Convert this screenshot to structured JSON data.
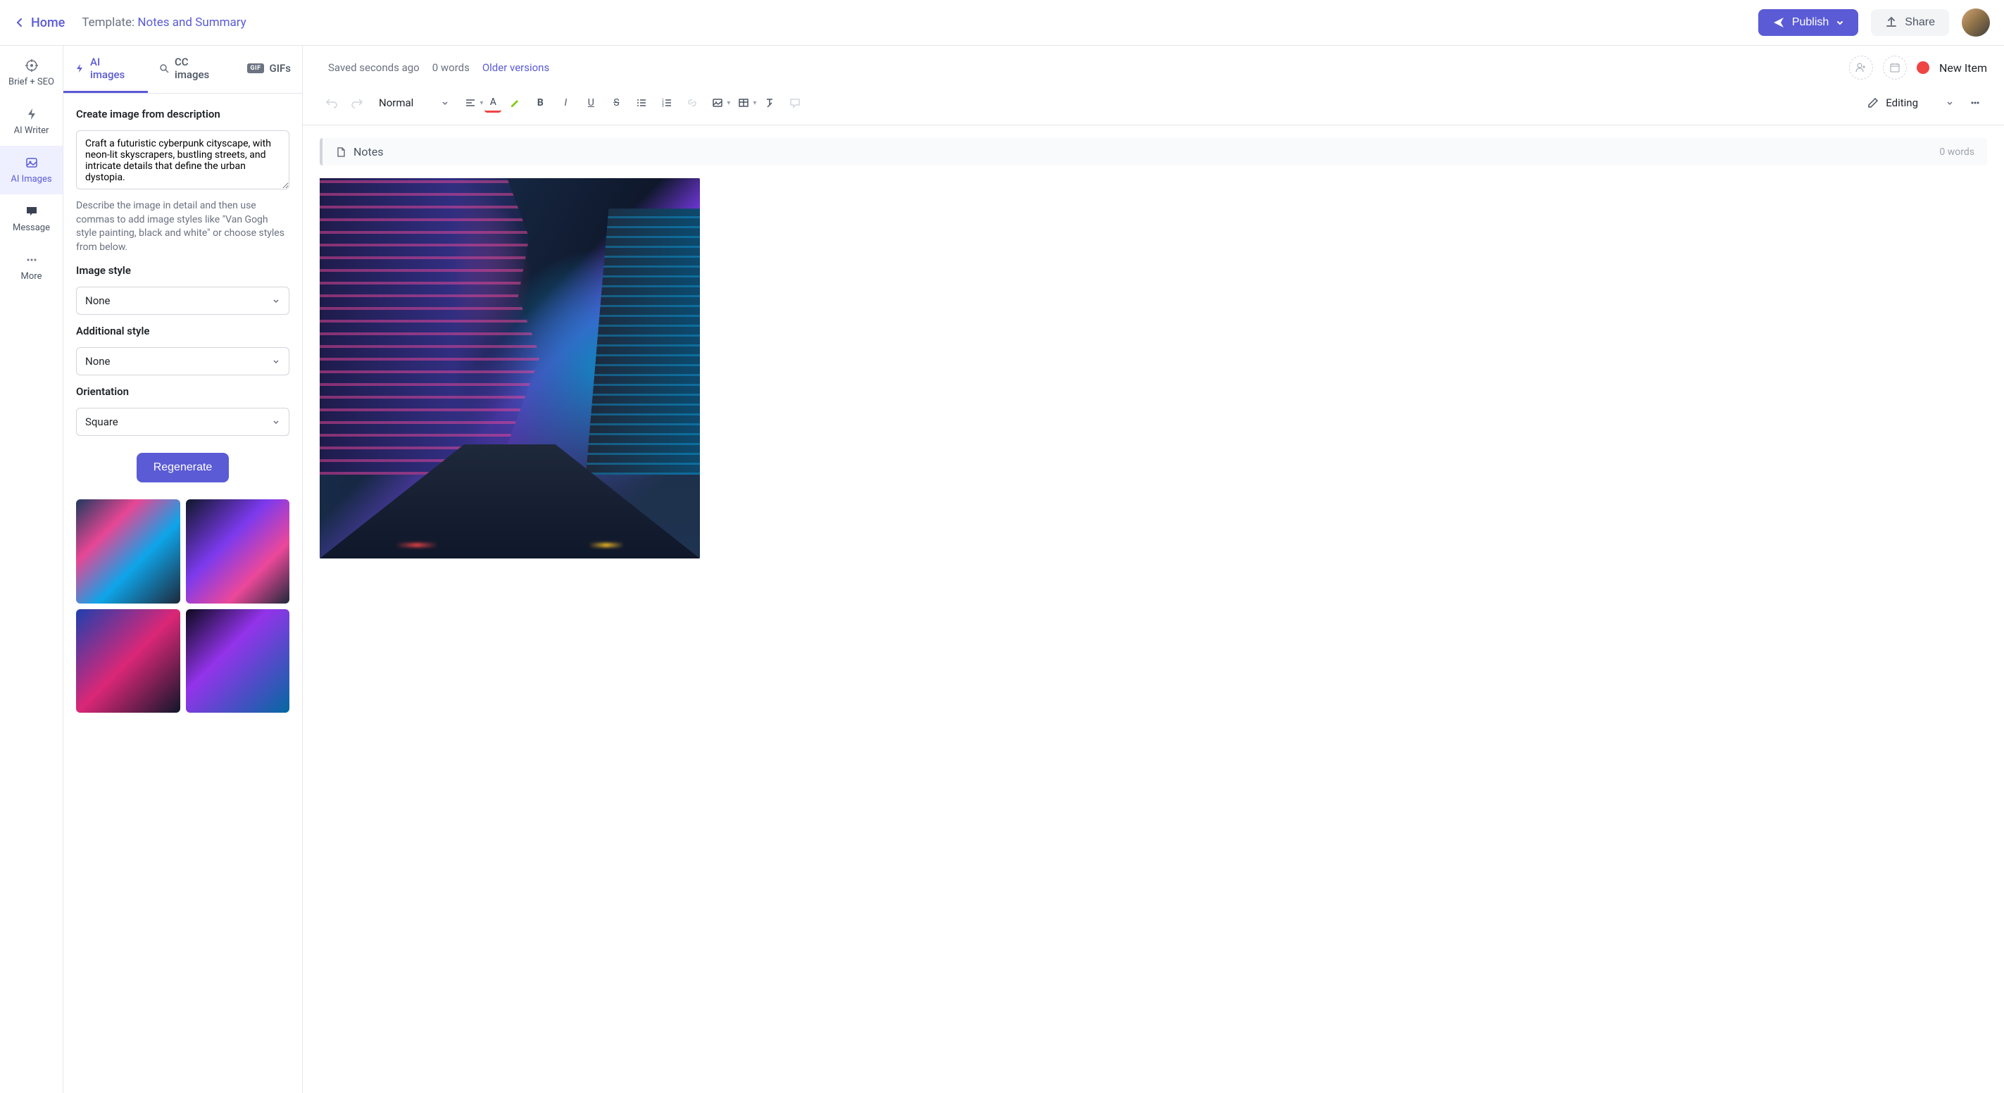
{
  "header": {
    "home_label": "Home",
    "template_prefix": "Template: ",
    "template_name": "Notes and Summary",
    "publish_label": "Publish",
    "share_label": "Share"
  },
  "rail": {
    "items": [
      {
        "label": "Brief + SEO"
      },
      {
        "label": "AI Writer"
      },
      {
        "label": "AI Images"
      },
      {
        "label": "Message"
      },
      {
        "label": "More"
      }
    ]
  },
  "panel": {
    "tabs": {
      "ai_images": "AI images",
      "cc_images": "CC images",
      "gifs": "GIFs"
    },
    "create_label": "Create image from description",
    "description_value": "Craft a futuristic cyberpunk cityscape, with neon-lit skyscrapers, bustling streets, and intricate details that define the urban dystopia.",
    "help_text": "Describe the image in detail and then use commas to add image styles like \"Van Gogh style painting, black and white\" or choose styles from below.",
    "image_style_label": "Image style",
    "image_style_value": "None",
    "additional_style_label": "Additional style",
    "additional_style_value": "None",
    "orientation_label": "Orientation",
    "orientation_value": "Square",
    "regenerate_label": "Regenerate"
  },
  "editor": {
    "saved_text": "Saved seconds ago",
    "word_count_top": "0 words",
    "older_versions": "Older versions",
    "status_label": "New Item",
    "paragraph_style": "Normal",
    "mode_label": "Editing",
    "notes_title": "Notes",
    "notes_word_count": "0 words"
  }
}
